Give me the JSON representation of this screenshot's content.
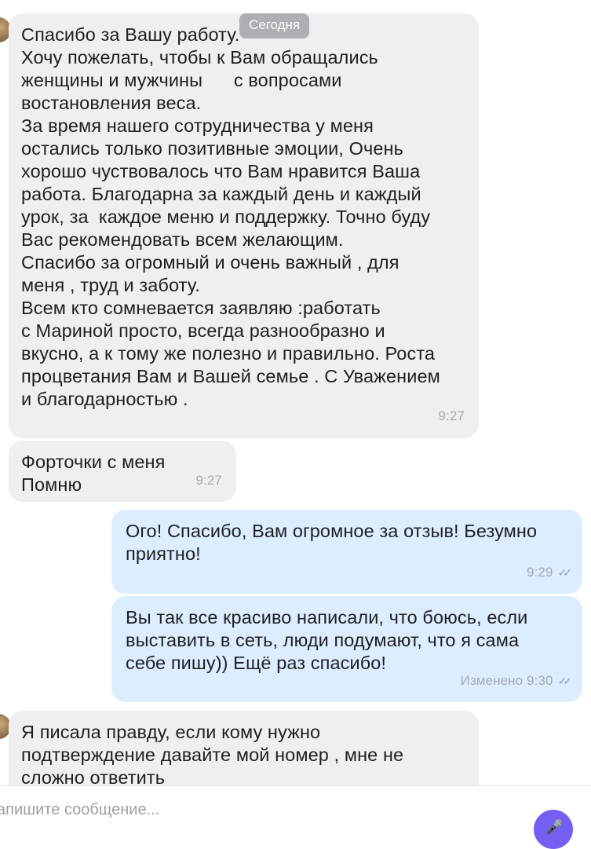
{
  "chat": {
    "date_separator": "Сегодня",
    "messages": [
      {
        "direction": "in",
        "text": "Спасибо за Вашу работу.\nХочу пожелать, чтобы к Вам обращались\nженщины и мужчины      с вопросами\nвостановления веса.\nЗа время нашего сотрудничества у меня\nостались только позитивные эмоции, Очень\nхорошо чуствовалось что Вам нравится Ваша\nработа. Благодарна за каждый день и каждый\nурок, за  каждое меню и поддержку. Точно буду\nВас рекомендовать всем желающим.\nСпасибо за огромный и очень важный , для\nменя , труд и заботу.\nВсем кто сомневается заявляю :работать\nс Мариной просто, всегда разнообразно и\nвкусно, а к тому же полезно и правильно. Роста\nпроцветания Вам и Вашей семье . С Уважением\nи благодарностью .",
        "time": "9:27"
      },
      {
        "direction": "in",
        "text": "Форточки с меня\nПомню",
        "time": "9:27"
      },
      {
        "direction": "out",
        "text": "Ого! Спасибо, Вам огромное за отзыв! Безумно\nприятно!",
        "time": "9:29",
        "status_icon": "double-check-icon"
      },
      {
        "direction": "out",
        "text": "Вы так все красиво написали, что боюсь, если\nвыставить в сеть, люди подумают, что я сама\nсебе пишу)) Ещё раз спасибо!",
        "edited_label": "Изменено",
        "time": "9:30",
        "status_icon": "double-check-icon"
      },
      {
        "direction": "in",
        "text": "Я писала правду, если кому нужно\nподтверждение давайте мой номер , мне не\nсложно ответить"
      }
    ]
  },
  "composer": {
    "placeholder": "апишите сообщение...",
    "send_icon": "microphone-icon"
  },
  "colors": {
    "incoming_bubble": "#efeff1",
    "outgoing_bubble": "#dcedff",
    "accent": "#7360f2",
    "meta_text": "#a5a9b0"
  }
}
